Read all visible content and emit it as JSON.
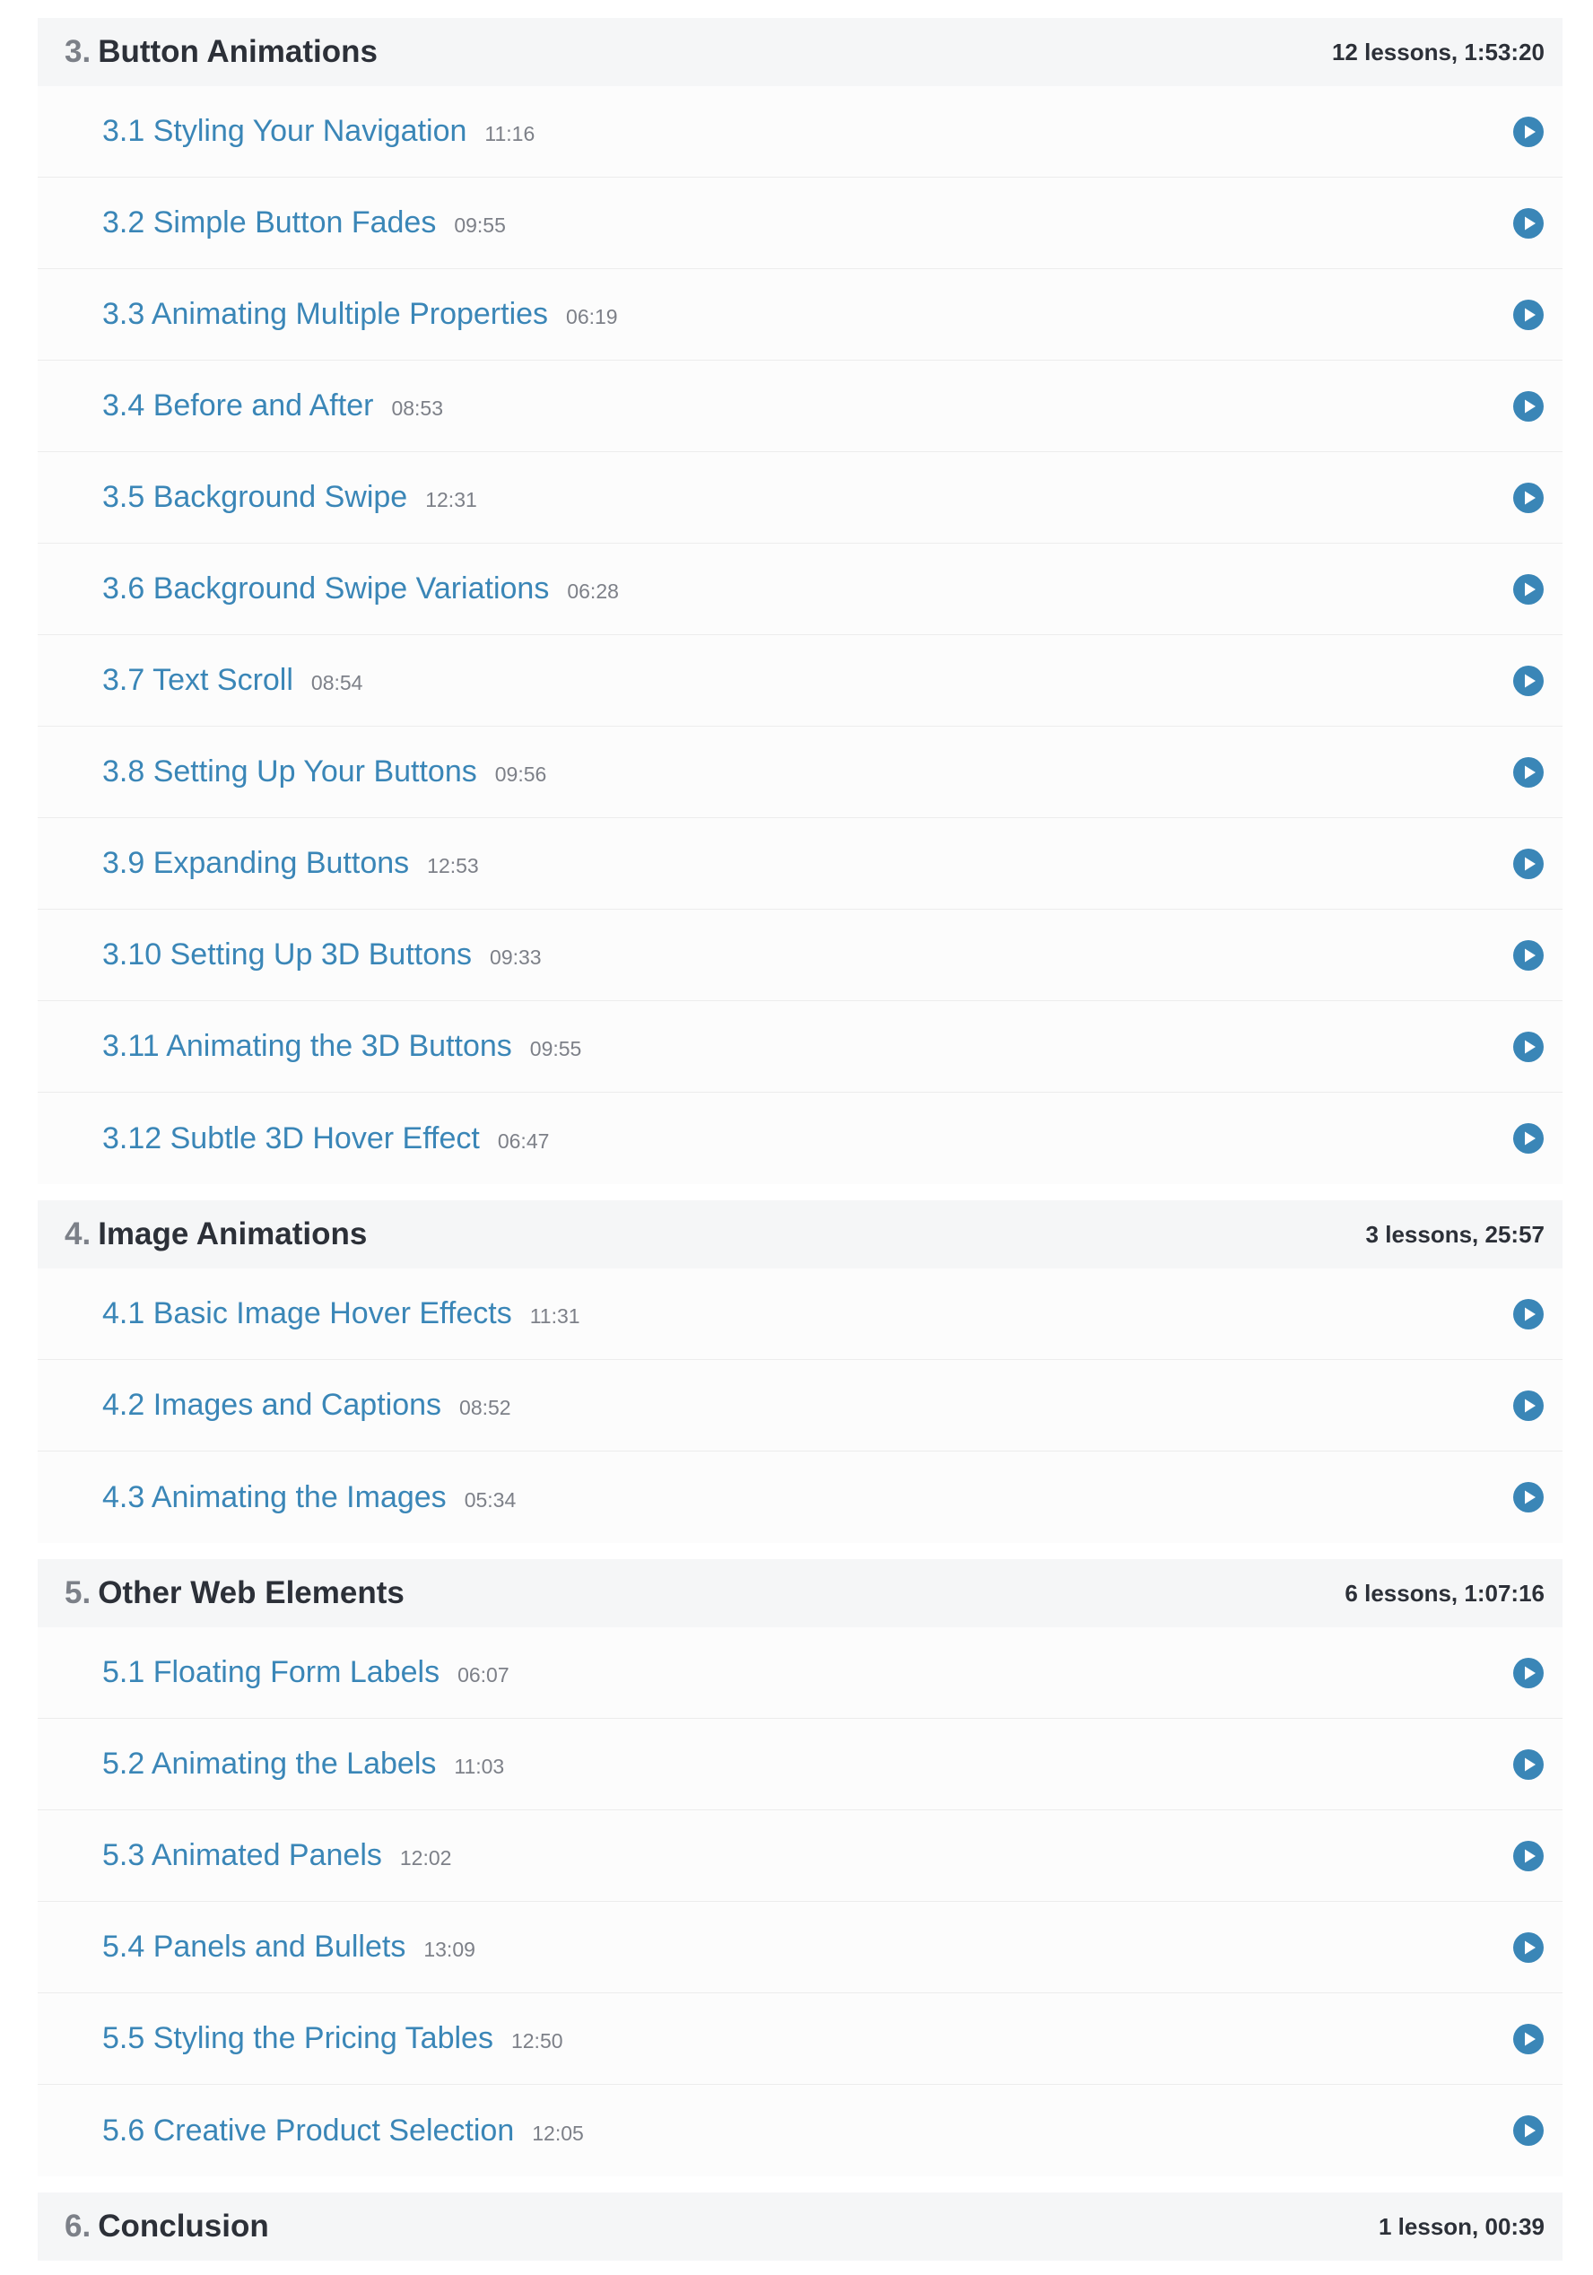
{
  "accent_color": "#3a86b7",
  "sections": [
    {
      "number": "3.",
      "title": "Button Animations",
      "meta": "12 lessons, 1:53:20",
      "lessons": [
        {
          "title": "3.1 Styling Your Navigation",
          "duration": "11:16",
          "icon": "play-circle-icon"
        },
        {
          "title": "3.2 Simple Button Fades",
          "duration": "09:55",
          "icon": "play-circle-icon"
        },
        {
          "title": "3.3 Animating Multiple Properties",
          "duration": "06:19",
          "icon": "play-circle-icon"
        },
        {
          "title": "3.4 Before and After",
          "duration": "08:53",
          "icon": "play-circle-icon"
        },
        {
          "title": "3.5 Background Swipe",
          "duration": "12:31",
          "icon": "play-circle-icon"
        },
        {
          "title": "3.6 Background Swipe Variations",
          "duration": "06:28",
          "icon": "play-circle-icon"
        },
        {
          "title": "3.7 Text Scroll",
          "duration": "08:54",
          "icon": "play-circle-icon"
        },
        {
          "title": "3.8 Setting Up Your Buttons",
          "duration": "09:56",
          "icon": "play-circle-icon"
        },
        {
          "title": "3.9 Expanding Buttons",
          "duration": "12:53",
          "icon": "play-circle-icon"
        },
        {
          "title": "3.10 Setting Up 3D Buttons",
          "duration": "09:33",
          "icon": "play-circle-icon"
        },
        {
          "title": "3.11 Animating the 3D Buttons",
          "duration": "09:55",
          "icon": "play-circle-icon"
        },
        {
          "title": "3.12 Subtle 3D Hover Effect",
          "duration": "06:47",
          "icon": "play-circle-icon"
        }
      ]
    },
    {
      "number": "4.",
      "title": "Image Animations",
      "meta": "3 lessons, 25:57",
      "lessons": [
        {
          "title": "4.1 Basic Image Hover Effects",
          "duration": "11:31",
          "icon": "play-circle-icon"
        },
        {
          "title": "4.2 Images and Captions",
          "duration": "08:52",
          "icon": "play-circle-icon"
        },
        {
          "title": "4.3 Animating the Images",
          "duration": "05:34",
          "icon": "play-circle-icon"
        }
      ]
    },
    {
      "number": "5.",
      "title": "Other Web Elements",
      "meta": "6 lessons, 1:07:16",
      "lessons": [
        {
          "title": "5.1 Floating Form Labels",
          "duration": "06:07",
          "icon": "play-circle-icon"
        },
        {
          "title": "5.2 Animating the Labels",
          "duration": "11:03",
          "icon": "play-circle-icon"
        },
        {
          "title": "5.3 Animated Panels",
          "duration": "12:02",
          "icon": "play-circle-icon"
        },
        {
          "title": "5.4 Panels and Bullets",
          "duration": "13:09",
          "icon": "play-circle-icon"
        },
        {
          "title": "5.5 Styling the Pricing Tables",
          "duration": "12:50",
          "icon": "play-circle-icon"
        },
        {
          "title": "5.6 Creative Product Selection",
          "duration": "12:05",
          "icon": "play-circle-icon"
        }
      ]
    },
    {
      "number": "6.",
      "title": "Conclusion",
      "meta": "1 lesson, 00:39",
      "lessons": []
    }
  ]
}
